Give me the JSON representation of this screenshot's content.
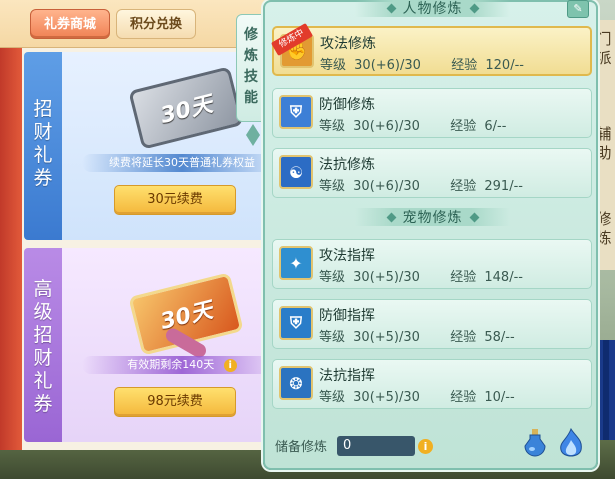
{
  "shop": {
    "tabs": [
      "礼券商城",
      "积分兑换"
    ],
    "cards": [
      {
        "side_label": [
          "招",
          "财",
          "礼",
          "券"
        ],
        "ticket_text": "30天",
        "note": "续费将延长30天普通礼券权益",
        "button": "30元续费"
      },
      {
        "side_label": [
          "高",
          "级",
          "招",
          "财",
          "礼",
          "券"
        ],
        "ticket_text": "30天",
        "note": "有效期剩余140天",
        "button": "98元续费"
      }
    ]
  },
  "skills": {
    "tab_label": [
      "修",
      "炼",
      "技",
      "能"
    ],
    "player_section": "人物修炼",
    "pet_section": "宠物修炼",
    "level_label": "等级",
    "exp_label": "经验",
    "selected_badge": "修炼中",
    "player_rows": [
      {
        "name": "攻法修炼",
        "level": "30(+6)/30",
        "exp": "120/--",
        "icon": "attack-magic-icon"
      },
      {
        "name": "防御修炼",
        "level": "30(+6)/30",
        "exp": "6/--",
        "icon": "defense-icon"
      },
      {
        "name": "法抗修炼",
        "level": "30(+6)/30",
        "exp": "291/--",
        "icon": "magic-resist-icon"
      }
    ],
    "pet_rows": [
      {
        "name": "攻法指挥",
        "level": "30(+5)/30",
        "exp": "148/--",
        "icon": "pet-attack-icon"
      },
      {
        "name": "防御指挥",
        "level": "30(+5)/30",
        "exp": "58/--",
        "icon": "pet-defense-icon"
      },
      {
        "name": "法抗指挥",
        "level": "30(+5)/30",
        "exp": "10/--",
        "icon": "pet-resist-icon"
      }
    ],
    "storage_label": "储备修炼",
    "storage_value": "0"
  },
  "background_text": [
    "门",
    "派",
    "辅",
    "助",
    "修",
    "炼"
  ],
  "colors": {
    "accent_gold": "#e0b94d",
    "panel_teal": "#bfe3d6",
    "badge_red": "#e23b2b"
  }
}
